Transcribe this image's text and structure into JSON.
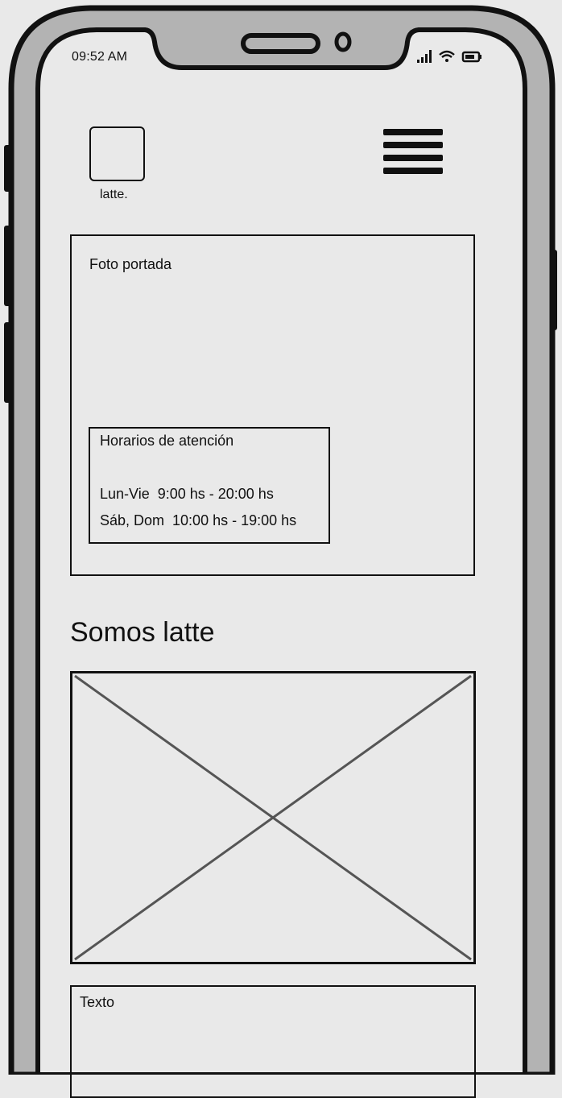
{
  "status_bar": {
    "time": "09:52 AM",
    "icons": [
      "signal-icon",
      "wifi-icon",
      "battery-icon"
    ]
  },
  "header": {
    "logo_label": "latte.",
    "menu_icon": "hamburger-menu-icon"
  },
  "hero": {
    "label": "Foto portada",
    "hours": {
      "title": "Horarios de atención",
      "weekdays": "Lun-Vie  9:00 hs - 20:00 hs",
      "weekend": "Sáb, Dom  10:00 hs - 19:00 hs"
    }
  },
  "about": {
    "title": "Somos latte",
    "image_icon": "image-placeholder-icon",
    "text_label": "Texto"
  },
  "colors": {
    "background": "#e9e9e9",
    "ink": "#111111",
    "frame_gray": "#b3b3b3"
  }
}
